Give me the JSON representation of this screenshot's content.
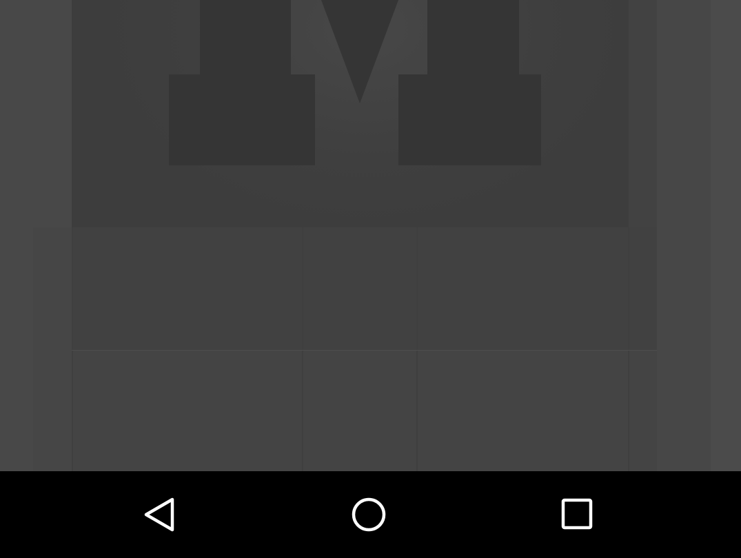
{
  "screen": {
    "background_color": "#4a4a4a",
    "logo_color": "#353535"
  },
  "nav_bar": {
    "background_color": "#000000",
    "icon_color": "#ffffff",
    "buttons": [
      {
        "icon": "back-icon"
      },
      {
        "icon": "home-icon"
      },
      {
        "icon": "recents-icon"
      }
    ]
  }
}
